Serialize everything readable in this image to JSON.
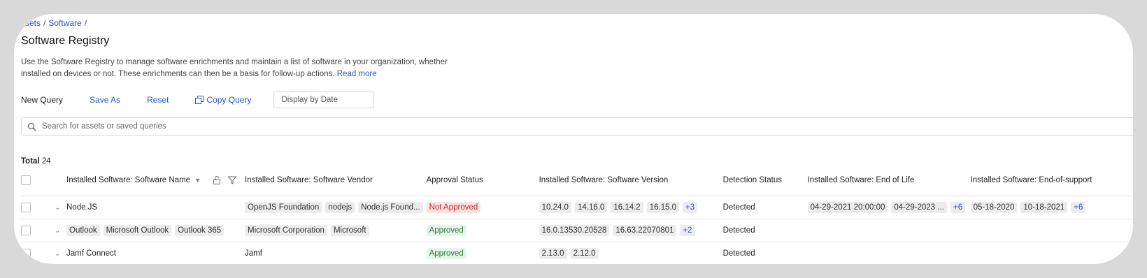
{
  "breadcrumb": {
    "item1": "ssets",
    "item2": "Software",
    "sep": "/"
  },
  "page": {
    "title": "Software Registry",
    "description": "Use the Software Registry to manage software enrichments and maintain a list of software in your organization, whether installed on devices or not. These enrichments can then be a basis for follow-up actions.",
    "read_more": "Read more"
  },
  "toolbar": {
    "new_query": "New Query",
    "save_as": "Save As",
    "reset": "Reset",
    "copy_query": "Copy Query",
    "display_by_date_placeholder": "Display by Date"
  },
  "search": {
    "placeholder": "Search for assets or saved queries",
    "icon": "search-icon"
  },
  "total": {
    "label": "Total",
    "count": "24"
  },
  "table": {
    "headers": {
      "name": "Installed Software: Software Name",
      "vendor": "Installed Software: Software Vendor",
      "approval": "Approval Status",
      "version": "Installed Software: Software Version",
      "detection": "Detection Status",
      "eol": "Installed Software: End of Life",
      "eos": "Installed Software: End-of-support"
    },
    "rows": [
      {
        "name_plain": "Node.JS",
        "vendors": [
          "OpenJS Foundation",
          "nodejs",
          "Node.js Found..."
        ],
        "approval": "Not Approved",
        "versions": [
          "10.24.0",
          "14.16.0",
          "16.14.2",
          "16.15.0"
        ],
        "versions_more": "+3",
        "detection": "Detected",
        "eol": [
          "04-29-2021 20:00:00",
          "04-29-2023 ..."
        ],
        "eol_more": "+6",
        "eos": [
          "05-18-2020",
          "10-18-2021"
        ],
        "eos_more": "+6"
      },
      {
        "names": [
          "Outlook",
          "Microsoft Outlook",
          "Outlook 365"
        ],
        "vendors": [
          "Microsoft Corporation",
          "Microsoft"
        ],
        "approval": "Approved",
        "versions": [
          "16.0.13530.20528",
          "16.63.22070801"
        ],
        "versions_more": "+2",
        "detection": "Detected"
      },
      {
        "name_plain": "Jamf Connect",
        "vendor_plain": "Jamf",
        "approval": "Approved",
        "versions": [
          "2.13.0",
          "2.12.0"
        ],
        "detection": "Detected"
      }
    ]
  },
  "colors": {
    "link": "#2a56c6",
    "not_approved": "#c62828",
    "approved": "#2e7d32"
  }
}
